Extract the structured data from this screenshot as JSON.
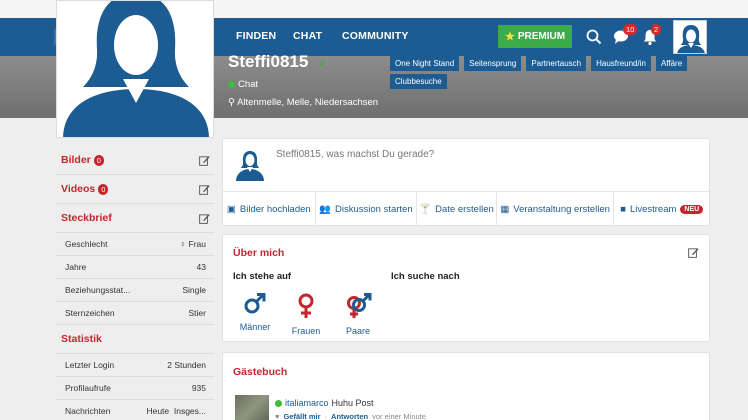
{
  "nav": {
    "links": [
      "FINDEN",
      "CHAT",
      "COMMUNITY"
    ],
    "premium_label": "PREMIUM",
    "chat_badge": "10",
    "notification_badge": "2"
  },
  "profile": {
    "username": "Steffi0815",
    "status": "Chat",
    "location": "Altenmelle, Melle, Niedersachsen"
  },
  "sidebar": {
    "bilder": {
      "label": "Bilder",
      "count": "0"
    },
    "videos": {
      "label": "Videos",
      "count": "0"
    },
    "steckbrief": {
      "label": "Steckbrief",
      "rows": [
        {
          "key": "Geschlecht",
          "value": "Frau"
        },
        {
          "key": "Jahre",
          "value": "43"
        },
        {
          "key": "Beziehungsstat...",
          "value": "Single"
        },
        {
          "key": "Sternzeichen",
          "value": "Stier"
        }
      ]
    },
    "statistik": {
      "label": "Statistik",
      "rows": [
        {
          "key": "Letzter Login",
          "value": "2 Stunden"
        },
        {
          "key": "Profilaufrufe",
          "value": "935"
        },
        {
          "key": "Nachrichten",
          "value": "Heute  Insges..."
        }
      ]
    }
  },
  "post": {
    "prompt": "Steffi0815, was machst Du gerade?",
    "actions": [
      "Bilder hochladen",
      "Diskussion starten",
      "Date erstellen",
      "Veranstaltung erstellen",
      "Livestream"
    ],
    "new_badge": "NEU"
  },
  "about": {
    "title": "Über mich",
    "looking_title": "Ich stehe auf",
    "seeking_title": "Ich suche nach",
    "genders": [
      "Männer",
      "Frauen",
      "Paare"
    ],
    "tags": [
      "One Night Stand",
      "Seitensprung",
      "Partnertausch",
      "Hausfreund/in",
      "Affäre",
      "Clubbesuche"
    ]
  },
  "guestbook": {
    "title": "Gästebuch",
    "user": "italiamarco",
    "text": "Huhu Post",
    "like": "Gefällt mir",
    "reply": "Antworten",
    "time": "vor einer Minute"
  },
  "colors": {
    "nav_blue": "#1c5c93",
    "accent_red": "#c4262e",
    "premium_green": "#3dab46"
  }
}
